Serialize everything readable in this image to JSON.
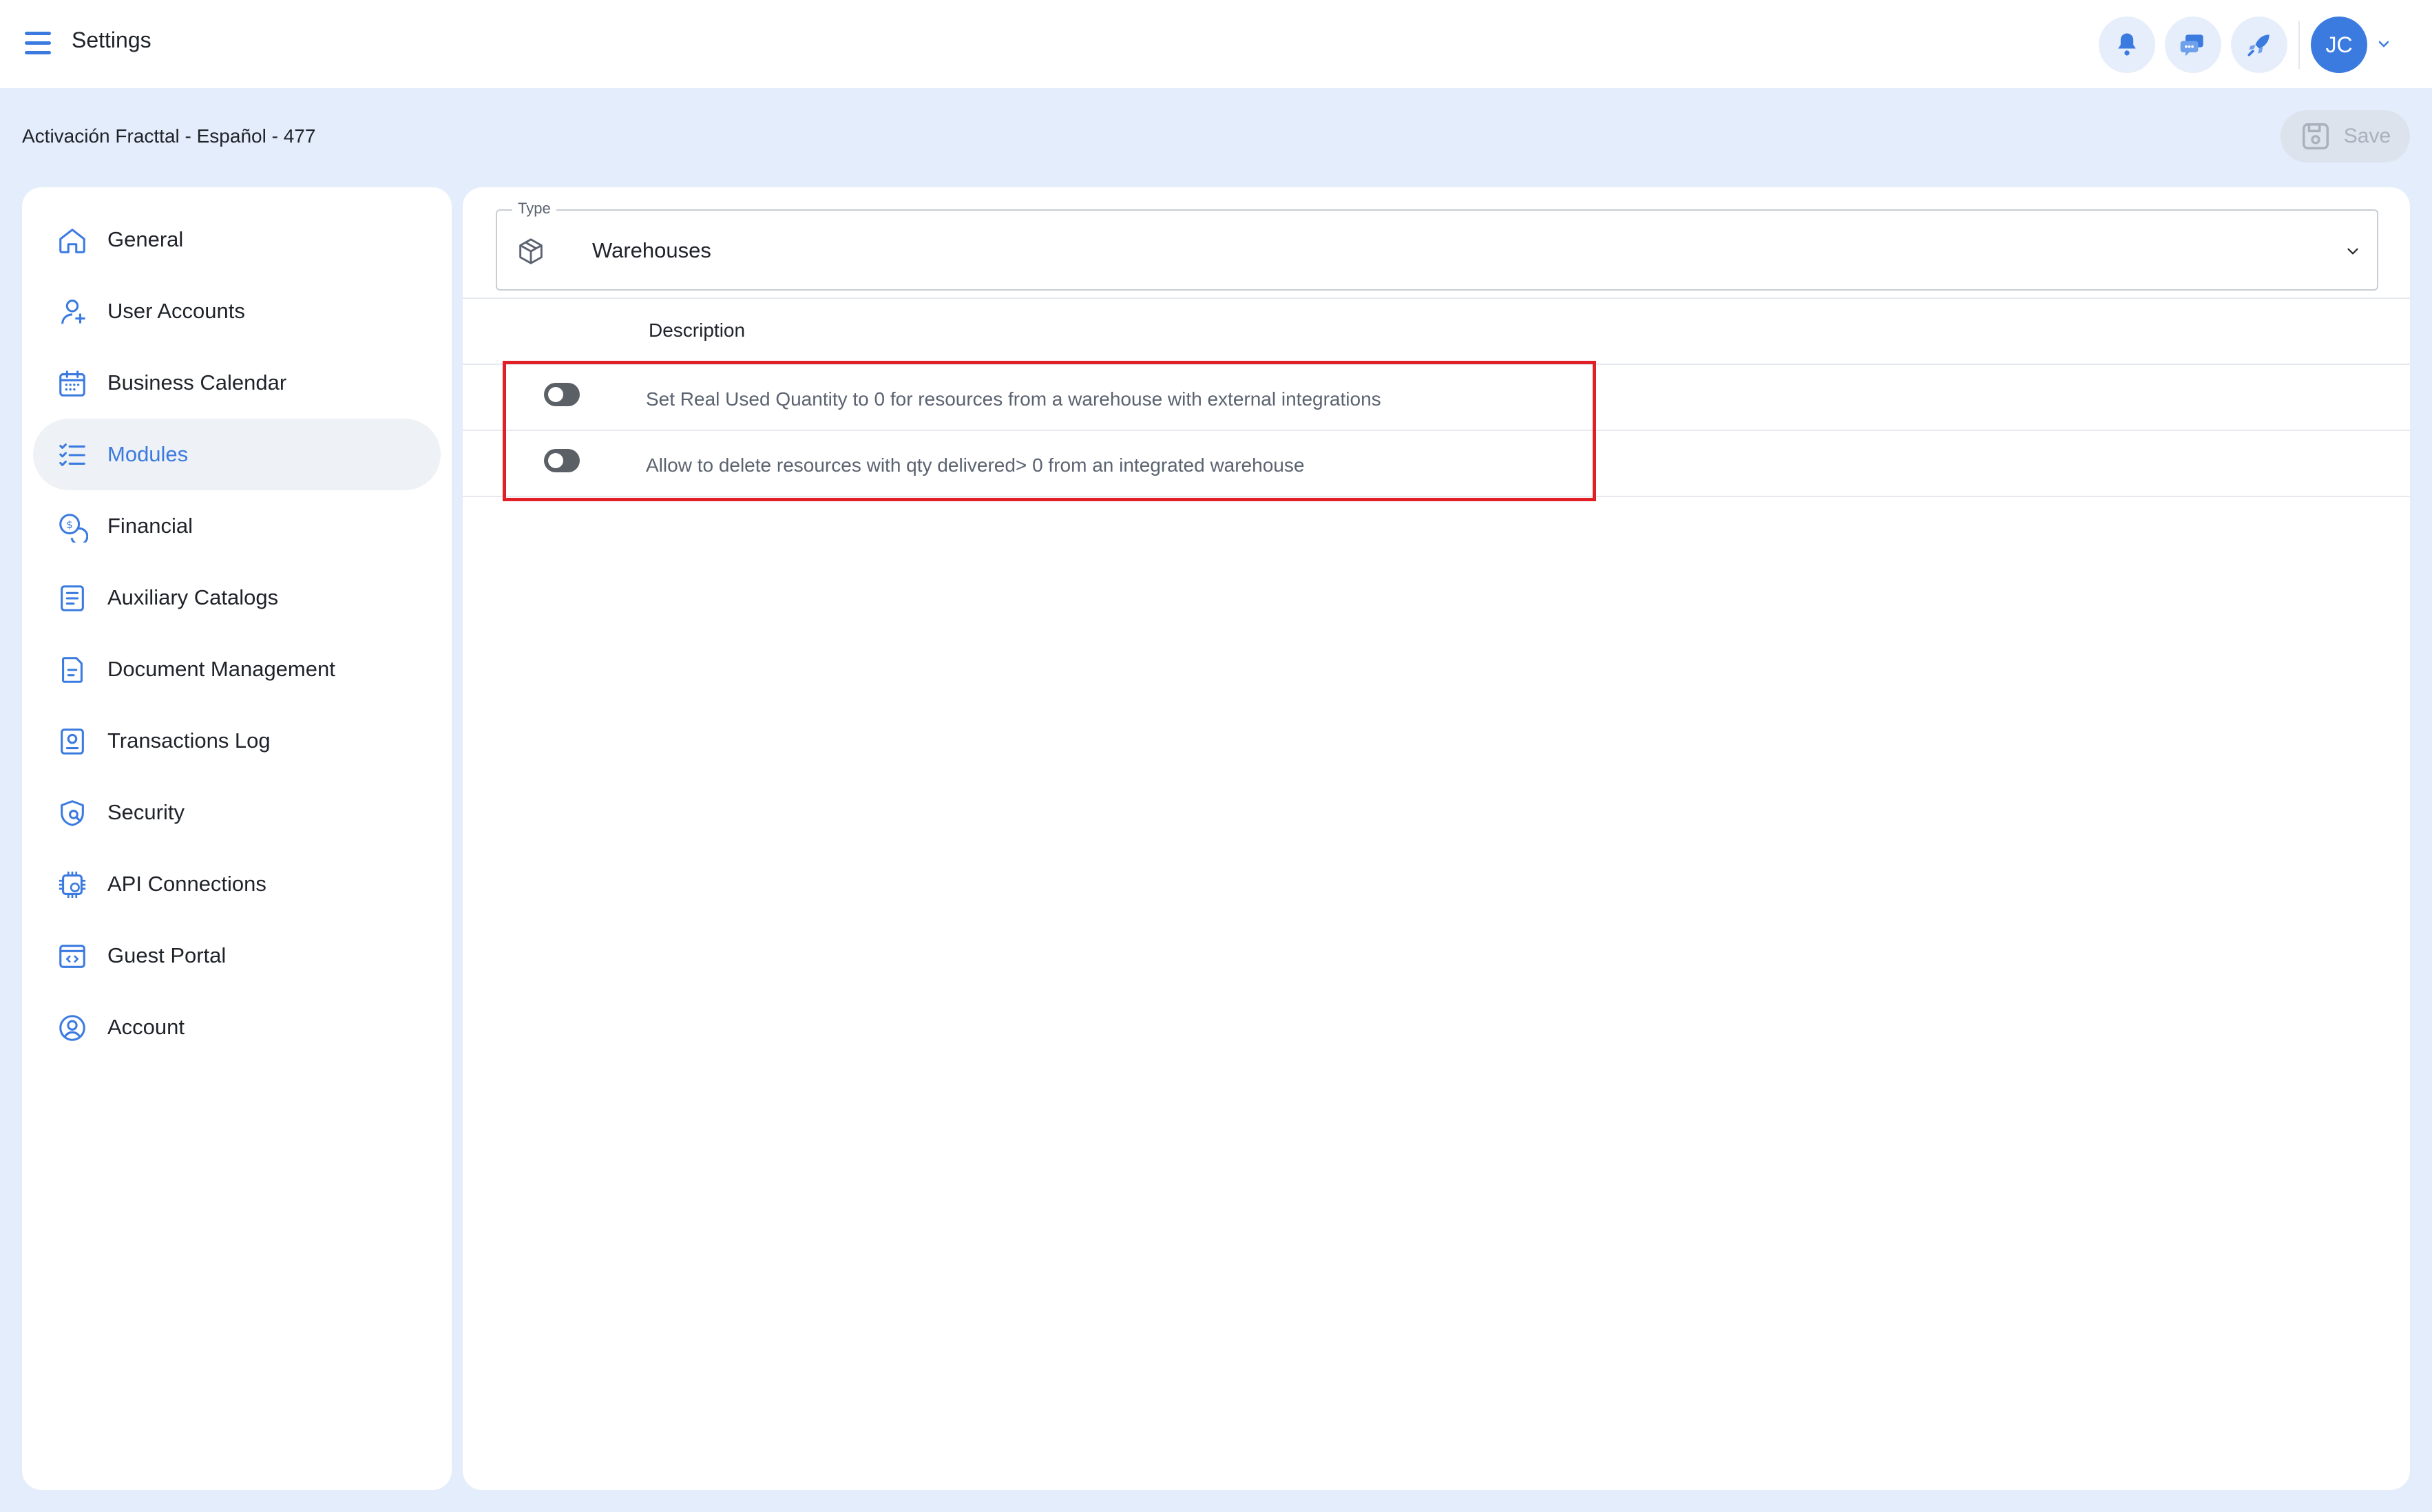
{
  "header": {
    "title": "Settings",
    "avatar_initials": "JC",
    "buttons": [
      "notifications-icon",
      "chat-icon",
      "rocket-icon"
    ]
  },
  "subheader": {
    "org_name": "Activación Fracttal - Español - 477",
    "save_label": "Save"
  },
  "sidebar": {
    "items": [
      {
        "label": "General",
        "icon": "home-icon",
        "active": false
      },
      {
        "label": "User Accounts",
        "icon": "user-icon",
        "active": false
      },
      {
        "label": "Business Calendar",
        "icon": "calendar-icon",
        "active": false
      },
      {
        "label": "Modules",
        "icon": "checklist-icon",
        "active": true
      },
      {
        "label": "Financial",
        "icon": "coin-icon",
        "active": false
      },
      {
        "label": "Auxiliary Catalogs",
        "icon": "catalog-icon",
        "active": false
      },
      {
        "label": "Document Management",
        "icon": "document-icon",
        "active": false
      },
      {
        "label": "Transactions Log",
        "icon": "log-icon",
        "active": false
      },
      {
        "label": "Security",
        "icon": "shield-icon",
        "active": false
      },
      {
        "label": "API Connections",
        "icon": "api-icon",
        "active": false
      },
      {
        "label": "Guest Portal",
        "icon": "portal-icon",
        "active": false
      },
      {
        "label": "Account",
        "icon": "account-icon",
        "active": false
      }
    ]
  },
  "main": {
    "type_field": {
      "label": "Type",
      "value": "Warehouses",
      "icon": "box-icon"
    },
    "table": {
      "header_description": "Description",
      "rows": [
        {
          "description": "Set Real Used Quantity to 0 for resources from a warehouse with external integrations",
          "enabled": false
        },
        {
          "description": "Allow to delete resources with qty delivered> 0 from an integrated warehouse",
          "enabled": false
        }
      ]
    }
  },
  "colors": {
    "accent": "#3b7be0",
    "background": "#e4edfb",
    "highlight": "#e01f26"
  }
}
